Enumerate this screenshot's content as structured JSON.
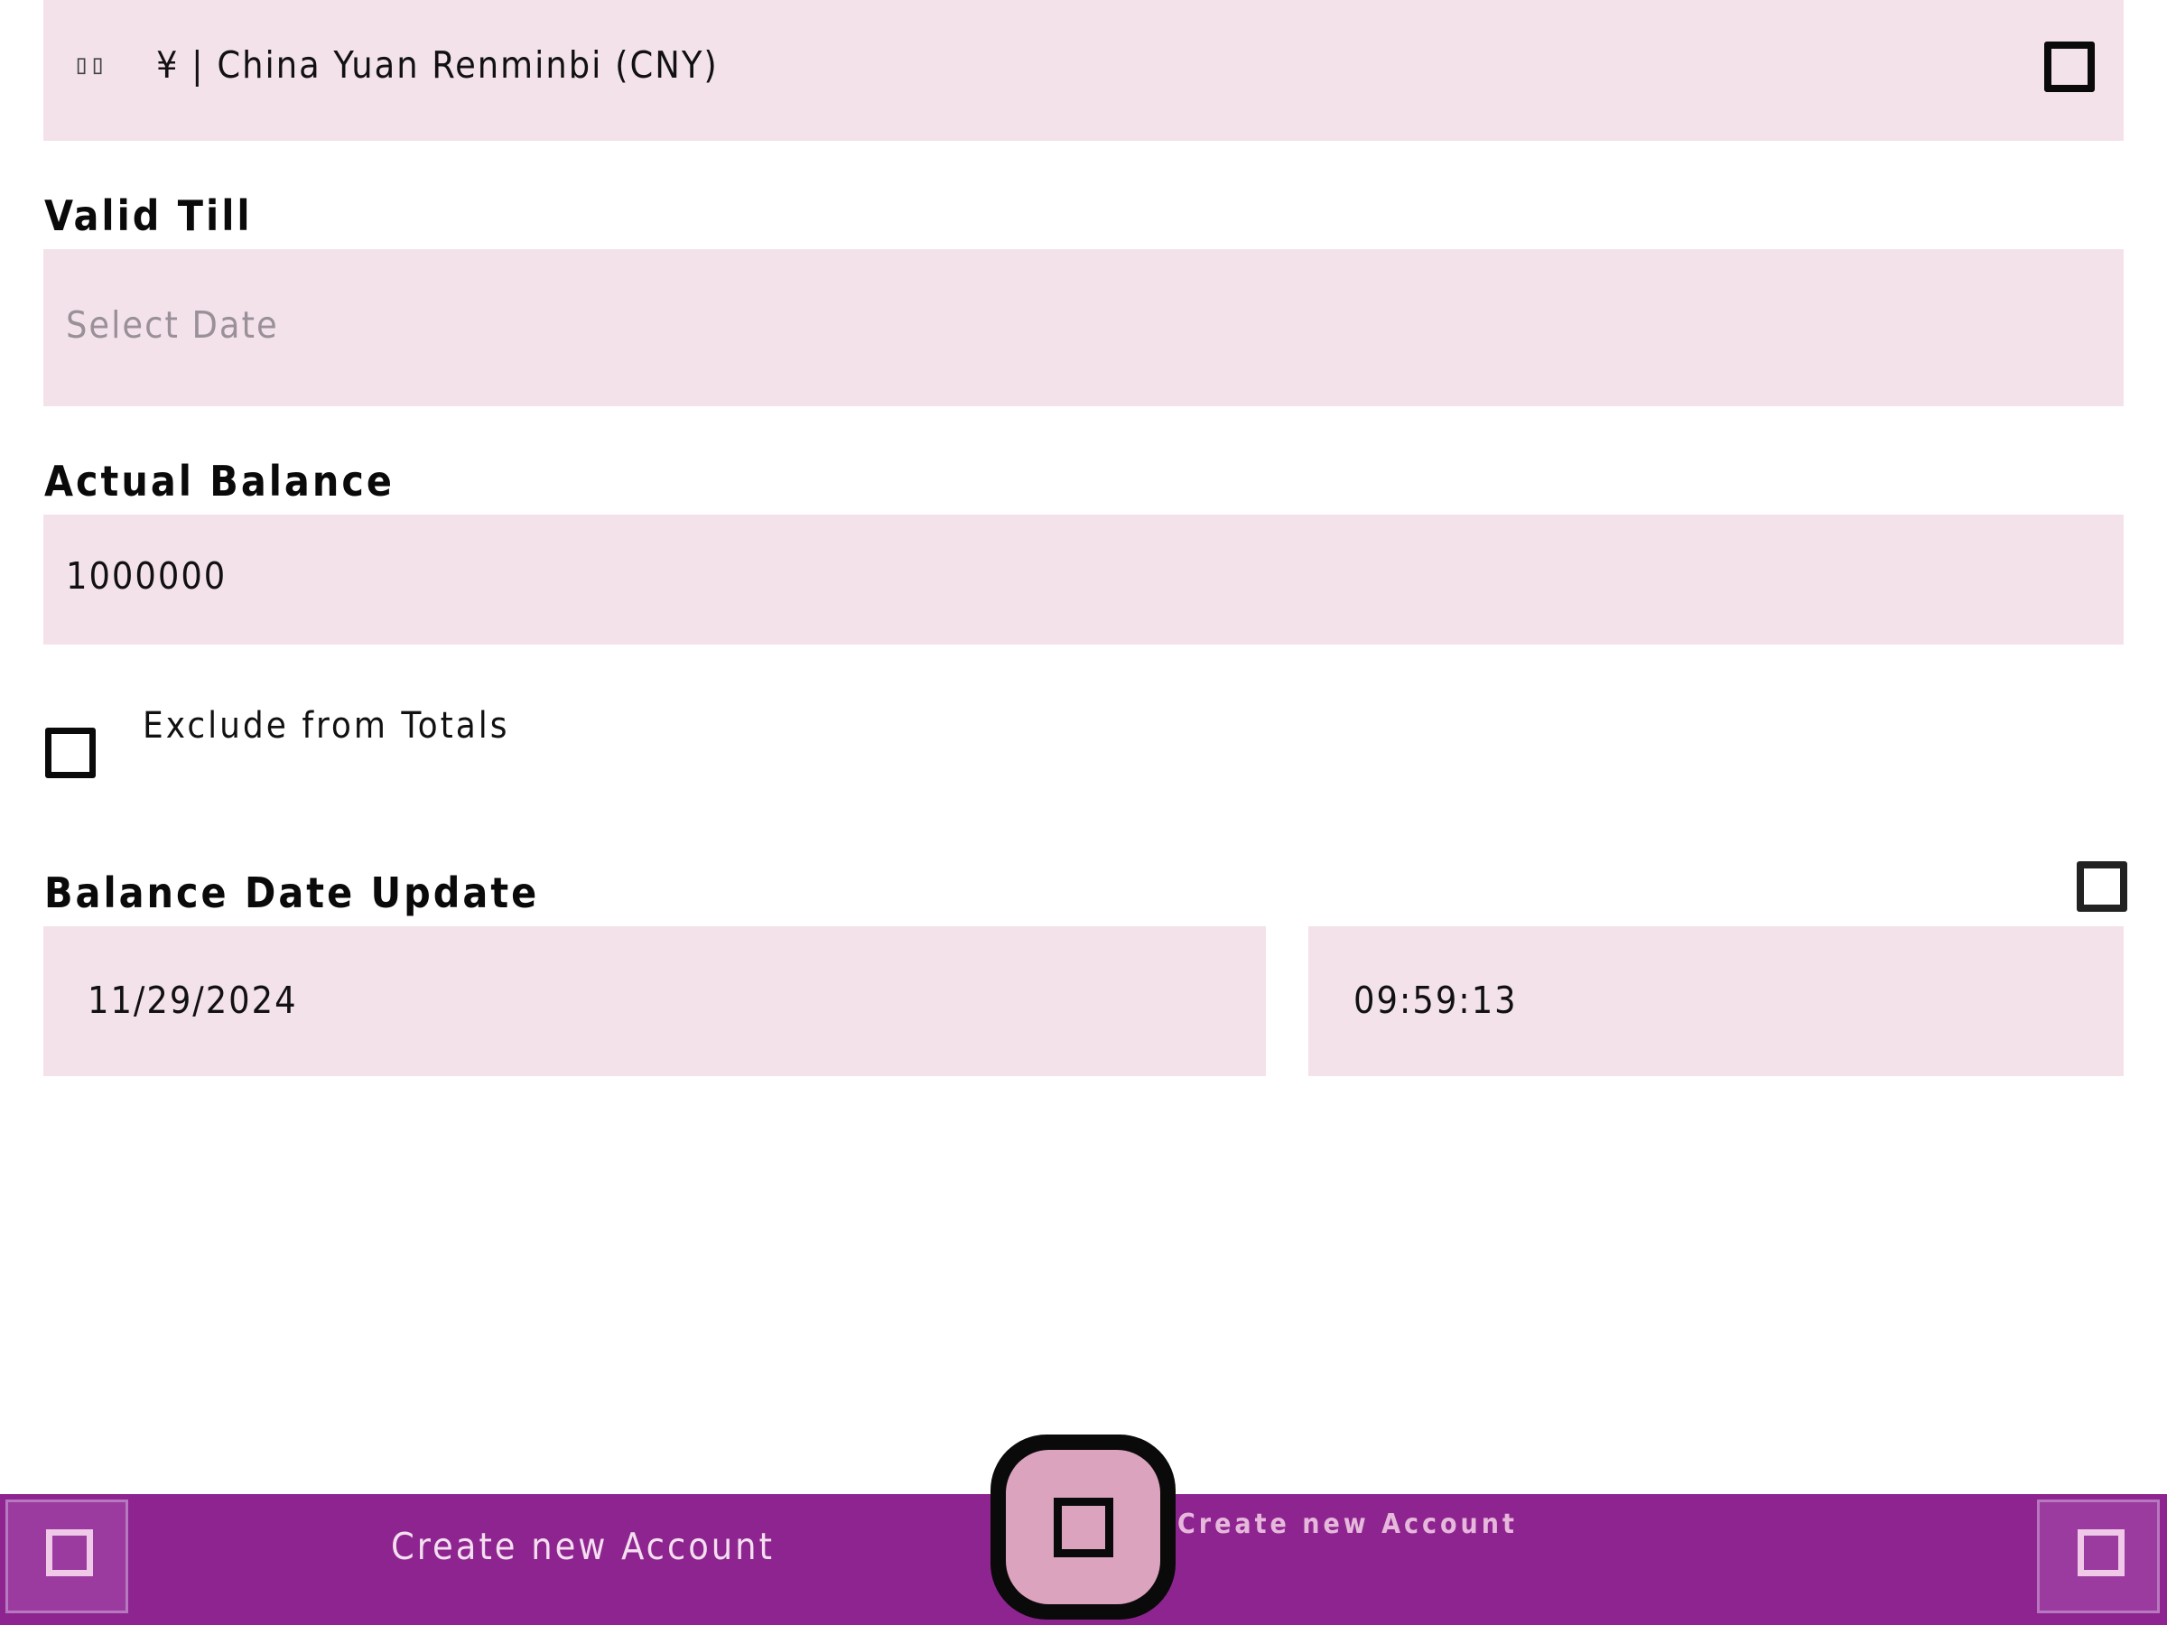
{
  "currency": {
    "flag_glyph": "▯▯",
    "value": "¥ | China Yuan Renminbi (CNY)",
    "dropdown_icon": "square-icon"
  },
  "valid_till": {
    "label": "Valid Till",
    "placeholder": "Select Date"
  },
  "actual_balance": {
    "label": "Actual Balance",
    "value": "1000000"
  },
  "exclude_from_totals": {
    "label": "Exclude from Totals",
    "checked": false
  },
  "balance_date_update": {
    "label": "Balance Date Update",
    "date": "11/29/2024",
    "time": "09:59:13",
    "toggle_icon": "square-icon"
  },
  "bottom_bar": {
    "primary_label": "Create new Account",
    "fab_label": "Create new Account",
    "left_icon": "square-icon",
    "right_icon": "square-icon",
    "background_color": "#8e248f"
  },
  "colors": {
    "field_background": "#f4e2eb",
    "fab_fill": "#dba3be"
  }
}
